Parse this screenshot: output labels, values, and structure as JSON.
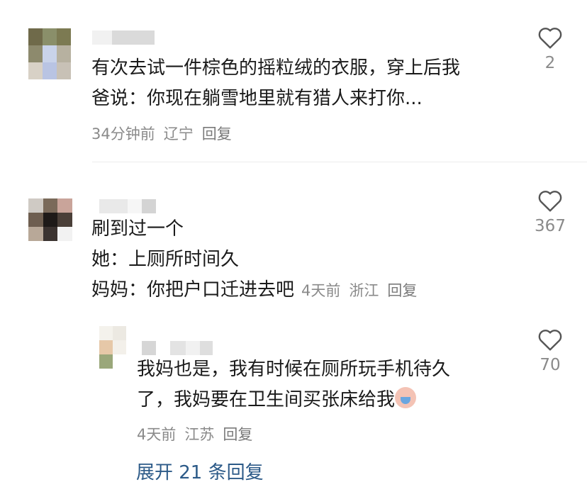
{
  "comments": [
    {
      "text_lines": [
        "有次去试一件棕色的摇粒绒的衣服，穿上后我",
        "爸说：你现在躺雪地里就有猎人来打你..."
      ],
      "time": "34分钟前",
      "location": "辽宁",
      "reply_label": "回复",
      "likes": "2"
    },
    {
      "text_lines": [
        "刷到过一个",
        "她：上厕所时间久",
        "妈妈：你把户口迁进去吧"
      ],
      "time": "4天前",
      "location": "浙江",
      "reply_label": "回复",
      "likes": "367"
    }
  ],
  "reply": {
    "text_lines": [
      "我妈也是，我有时候在厕所玩手机待久",
      "了，我妈要在卫生间买张床给我"
    ],
    "emoji": "crying-face-emoji",
    "time": "4天前",
    "location": "江苏",
    "reply_label": "回复",
    "likes": "70"
  },
  "expand_label": "展开 21 条回复",
  "colors": {
    "link": "#2c5a88",
    "meta": "#8a8a8a",
    "text": "#1a1a1a"
  }
}
